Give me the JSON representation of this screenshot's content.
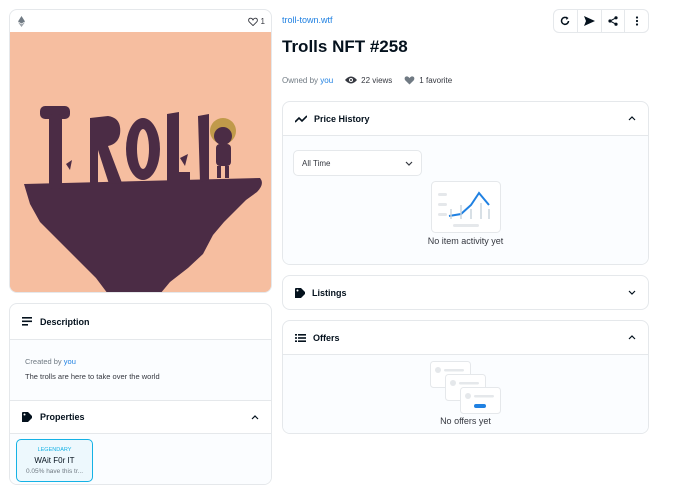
{
  "media": {
    "favorite_count": "1",
    "image_text": "TROLL"
  },
  "description": {
    "heading": "Description",
    "created_by_prefix": "Created by",
    "creator": "you",
    "text": "The trolls are here to take over the world"
  },
  "properties": {
    "heading": "Properties",
    "items": [
      {
        "type": "LEGENDARY",
        "value": "WAit F0r IT",
        "rarity": "0.05% have this tr..."
      }
    ]
  },
  "header": {
    "collection": "troll-town.wtf",
    "title": "Trolls NFT #258",
    "owned_by_prefix": "Owned by",
    "owner": "you",
    "views": "22 views",
    "favorites": "1 favorite"
  },
  "price_history": {
    "heading": "Price History",
    "range_selected": "All Time",
    "empty_text": "No item activity yet"
  },
  "listings": {
    "heading": "Listings"
  },
  "offers": {
    "heading": "Offers",
    "empty_text": "No offers yet"
  },
  "colors": {
    "accent": "#2081e2",
    "property_accent": "#15b2e5",
    "image_background": "#f6bea0",
    "image_foreground": "#4b2c45"
  }
}
